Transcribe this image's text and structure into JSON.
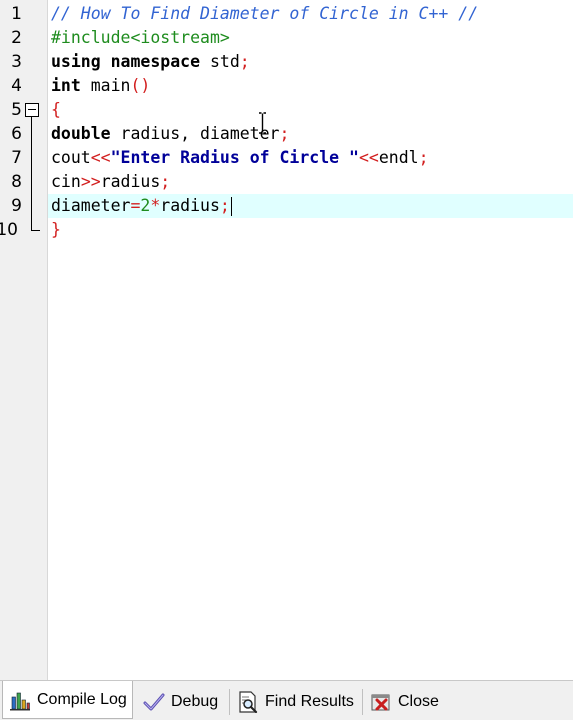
{
  "editor": {
    "lines": [
      {
        "number": "1",
        "text": "// How To Find Diameter of Circle in C++ //"
      },
      {
        "number": "2",
        "text": "#include<iostream>"
      },
      {
        "number": "3",
        "text": "using namespace std;"
      },
      {
        "number": "4",
        "text": "int main()"
      },
      {
        "number": "5",
        "text": "{"
      },
      {
        "number": "6",
        "text": "double radius, diameter;"
      },
      {
        "number": "7",
        "text": "cout<<\"Enter Radius of Circle \"<<endl;"
      },
      {
        "number": "8",
        "text": "cin>>radius;"
      },
      {
        "number": "9",
        "text": "diameter=2*radius;"
      },
      {
        "number": "10",
        "text": "}"
      }
    ],
    "current_line": "9",
    "colors": {
      "comment": "#3264d2",
      "preprocessor": "#1e8c1e",
      "symbol": "#d21e1e",
      "string": "#000099",
      "number": "#1e8c1e",
      "current_line_bg": "#e0ffff"
    }
  },
  "bottom_tabs": [
    {
      "label": "Compile Log",
      "icon": "bar-chart-icon",
      "active": true
    },
    {
      "label": "Debug",
      "icon": "checkmark-icon",
      "active": false
    },
    {
      "label": "Find Results",
      "icon": "find-document-icon",
      "active": false
    },
    {
      "label": "Close",
      "icon": "close-icon",
      "active": false
    }
  ]
}
